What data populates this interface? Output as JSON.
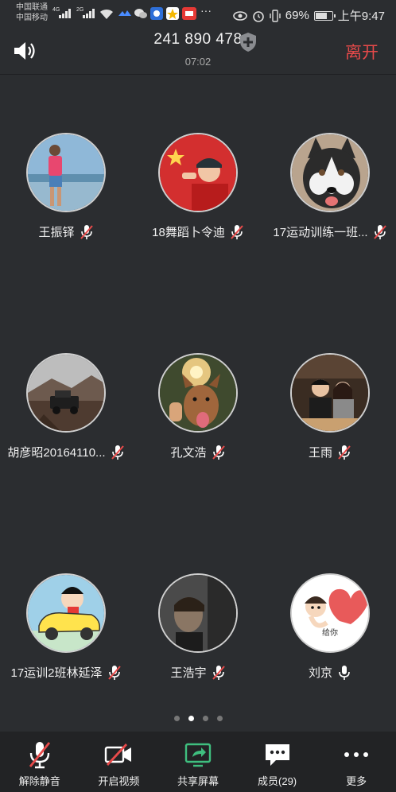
{
  "status_bar": {
    "carrier1": "中国联通",
    "carrier2": "中国移动",
    "net1": "4G",
    "net2": "2G",
    "battery": "69%",
    "time": "上午9:47"
  },
  "header": {
    "meeting_id": "241 890 478",
    "timer": "07:02",
    "leave_label": "离开"
  },
  "participants": [
    {
      "name": "王振铎",
      "muted": true,
      "avatar": "beach-person"
    },
    {
      "name": "18舞蹈卜令迪",
      "muted": true,
      "avatar": "boy-flag"
    },
    {
      "name": "17运动训练一班...",
      "muted": true,
      "avatar": "husky-dog"
    },
    {
      "name": "胡彦昭20164110...",
      "muted": true,
      "avatar": "jeep-landscape"
    },
    {
      "name": "孔文浩",
      "muted": true,
      "avatar": "dog-sunset"
    },
    {
      "name": "王雨",
      "muted": true,
      "avatar": "couple-photo"
    },
    {
      "name": "17运训2班林延泽",
      "muted": true,
      "avatar": "cartoon-car"
    },
    {
      "name": "王浩宇",
      "muted": true,
      "avatar": "shadow-photo"
    },
    {
      "name": "刘京",
      "muted": false,
      "avatar": "heart-sticker",
      "avatar_text": "给你"
    }
  ],
  "pager": {
    "pages": 4,
    "current": 2
  },
  "toolbar": {
    "unmute": "解除静音",
    "video": "开启视频",
    "share": "共享屏幕",
    "members": "成员(29)",
    "more": "更多"
  },
  "colors": {
    "background": "#2b2d30",
    "toolbar": "#222325",
    "leave": "#e84a4a",
    "mute_slash": "#e84a4a",
    "share": "#3fbf7f"
  }
}
